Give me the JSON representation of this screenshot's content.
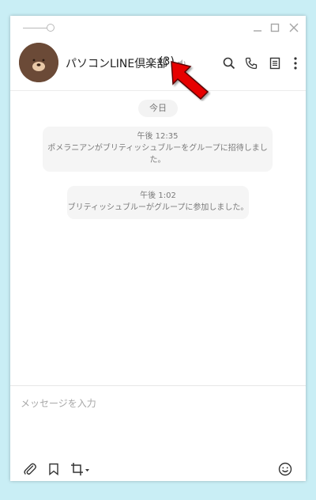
{
  "window": {
    "controls": [
      "minimize-icon",
      "maximize-icon",
      "close-icon"
    ]
  },
  "header": {
    "chat_name": "パソコンLINE倶楽部",
    "member_count": "(3)",
    "icons": [
      "search-icon",
      "phone-icon",
      "notes-icon",
      "more-icon"
    ]
  },
  "messages": {
    "date_label": "今日",
    "items": [
      {
        "time": "午後 12:35",
        "text": "ポメラニアンがブリティッシュブルーをグループに招待しまし",
        "text2": "た。"
      },
      {
        "time": "午後 1:02",
        "text": "ブリティッシュブルーがグループに参加しました。"
      }
    ]
  },
  "composer": {
    "placeholder": "メッセージを入力",
    "tools": [
      "paperclip-icon",
      "bookmark-icon",
      "crop-icon",
      "emoji-icon"
    ]
  },
  "colors": {
    "background": "#c9eef5",
    "annotation_arrow": "#e60000",
    "avatar_brown": "#6b4a37"
  }
}
